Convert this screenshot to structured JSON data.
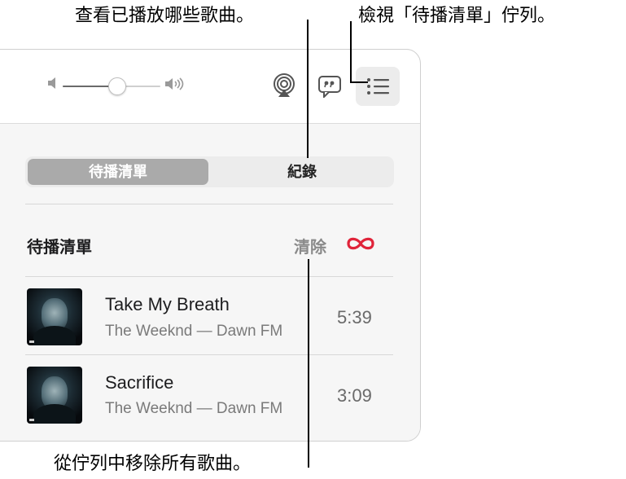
{
  "callouts": {
    "history": "查看已播放哪些歌曲。",
    "view_queue": "檢視「待播清單」佇列。",
    "clear": "從佇列中移除所有歌曲。"
  },
  "player": {
    "volume_level": 0.55,
    "icons": [
      "volume-low-icon",
      "volume-high-icon",
      "airplay-icon",
      "lyrics-icon",
      "queue-list-icon"
    ]
  },
  "segmented": {
    "tabs": [
      {
        "label": "待播清單",
        "selected": true
      },
      {
        "label": "紀錄",
        "selected": false
      }
    ]
  },
  "queue": {
    "heading": "待播清單",
    "clear_label": "清除",
    "autoplay_icon": "infinity-icon",
    "accent_color": "#e0243a",
    "songs": [
      {
        "title": "Take My Breath",
        "subtitle": "The Weeknd — Dawn FM",
        "duration": "5:39"
      },
      {
        "title": "Sacrifice",
        "subtitle": "The Weeknd — Dawn FM",
        "duration": "3:09"
      }
    ]
  }
}
